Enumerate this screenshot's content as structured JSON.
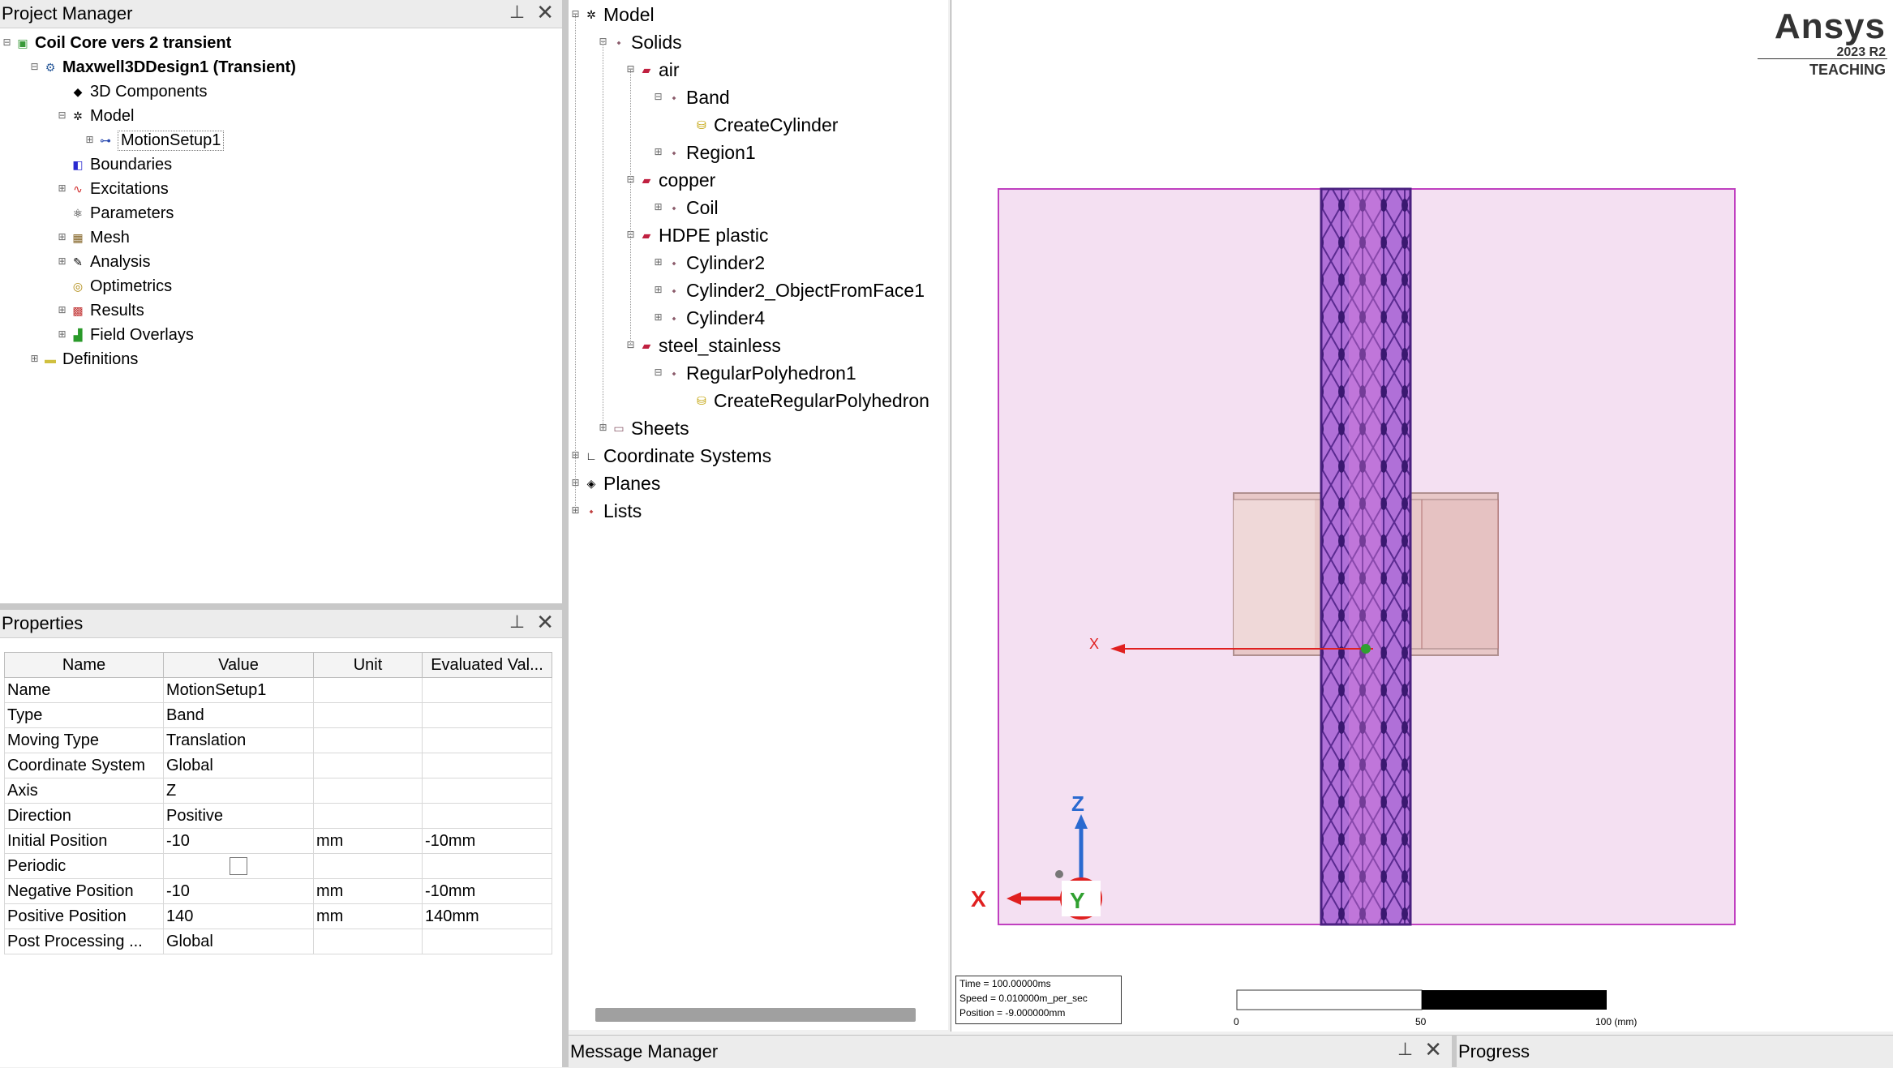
{
  "project_manager": {
    "title": "Project Manager",
    "items": [
      {
        "label": "Coil Core vers 2 transient"
      },
      {
        "label": "Maxwell3DDesign1 (Transient)"
      },
      {
        "label": "3D Components"
      },
      {
        "label": "Model"
      },
      {
        "label": "MotionSetup1"
      },
      {
        "label": "Boundaries"
      },
      {
        "label": "Excitations"
      },
      {
        "label": "Parameters"
      },
      {
        "label": "Mesh"
      },
      {
        "label": "Analysis"
      },
      {
        "label": "Optimetrics"
      },
      {
        "label": "Results"
      },
      {
        "label": "Field Overlays"
      },
      {
        "label": "Definitions"
      }
    ]
  },
  "properties": {
    "title": "Properties",
    "columns": [
      "Name",
      "Value",
      "Unit",
      "Evaluated Val..."
    ],
    "rows": [
      [
        "Name",
        "MotionSetup1",
        "",
        ""
      ],
      [
        "Type",
        "Band",
        "",
        ""
      ],
      [
        "Moving Type",
        "Translation",
        "",
        ""
      ],
      [
        "Coordinate System",
        "Global",
        "",
        ""
      ],
      [
        "Axis",
        "Z",
        "",
        ""
      ],
      [
        "Direction",
        "Positive",
        "",
        ""
      ],
      [
        "Initial Position",
        "-10",
        "mm",
        "-10mm"
      ],
      [
        "Periodic",
        "",
        "",
        ""
      ],
      [
        "Negative Position",
        "-10",
        "mm",
        "-10mm"
      ],
      [
        "Positive Position",
        "140",
        "mm",
        "140mm"
      ],
      [
        "Post Processing ...",
        "Global",
        "",
        ""
      ]
    ]
  },
  "model_tree": {
    "items": [
      {
        "label": "Model"
      },
      {
        "label": "Solids"
      },
      {
        "label": "air"
      },
      {
        "label": "Band"
      },
      {
        "label": "CreateCylinder"
      },
      {
        "label": "Region1"
      },
      {
        "label": "copper"
      },
      {
        "label": "Coil"
      },
      {
        "label": "HDPE plastic"
      },
      {
        "label": "Cylinder2"
      },
      {
        "label": "Cylinder2_ObjectFromFace1"
      },
      {
        "label": "Cylinder4"
      },
      {
        "label": "steel_stainless"
      },
      {
        "label": "RegularPolyhedron1"
      },
      {
        "label": "CreateRegularPolyhedron"
      },
      {
        "label": "Sheets"
      },
      {
        "label": "Coordinate Systems"
      },
      {
        "label": "Planes"
      },
      {
        "label": "Lists"
      }
    ]
  },
  "viewport": {
    "logo": "Ansys",
    "version": "2023 R2",
    "edition": "TEACHING",
    "axis_x": "X",
    "axis_z": "Z",
    "axis_y": "Y",
    "info": {
      "time": "Time       = 100.00000ms",
      "speed": "Speed     = 0.010000m_per_sec",
      "position": "Position = -9.000000mm"
    },
    "scale": {
      "t0": "0",
      "t1": "50",
      "t2": "100 (mm)"
    }
  },
  "message_manager": {
    "title": "Message Manager"
  },
  "progress": {
    "title": "Progress"
  }
}
